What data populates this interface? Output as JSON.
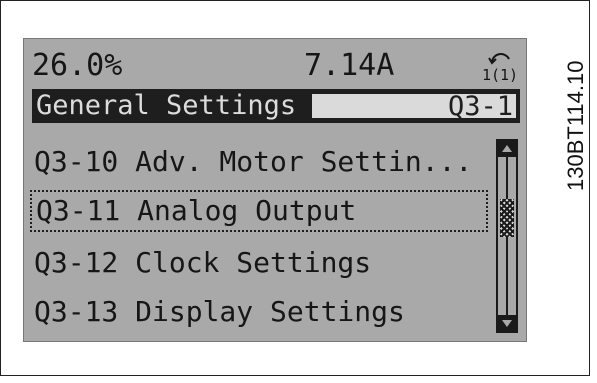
{
  "status": {
    "speed": "26.0%",
    "current": "7.14A",
    "setup_icon": "setup-indicator-icon",
    "setup_number": "1(1)"
  },
  "title_bar": {
    "group": "General Settings",
    "code": "Q3-1"
  },
  "menu": {
    "items": [
      {
        "label": "Q3-10 Adv. Motor Settin..."
      },
      {
        "label": "Q3-11 Analog Output"
      },
      {
        "label": "Q3-12 Clock Settings"
      },
      {
        "label": "Q3-13 Display Settings"
      }
    ],
    "selected_index": 1
  },
  "scrollbar": {
    "up_icon": "arrow-up-icon",
    "down_icon": "arrow-down-icon"
  },
  "figure_code": "130BT114.10",
  "colors": {
    "lcd_background": "#a9a9a9",
    "text": "#161616",
    "title_bar": "#1e1e1e"
  }
}
